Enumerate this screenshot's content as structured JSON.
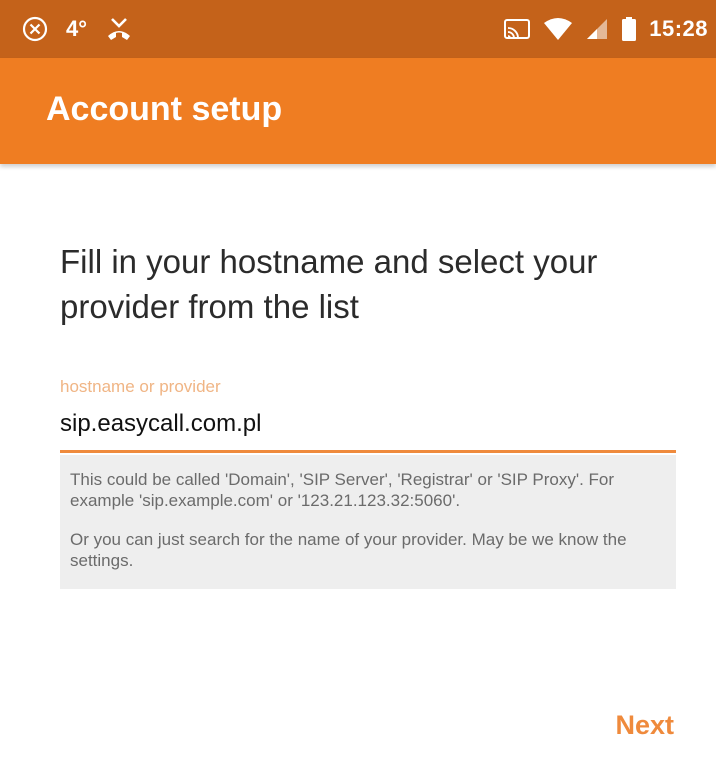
{
  "status_bar": {
    "left_icons": [
      "close-circle-icon",
      "phone-missed-icon"
    ],
    "temperature": "4°",
    "right_icons": [
      "cast-icon",
      "wifi-icon",
      "signal-icon",
      "battery-icon"
    ],
    "time": "15:28"
  },
  "app_bar": {
    "title": "Account setup"
  },
  "main": {
    "heading": "Fill in your hostname and select your provider from the list",
    "field": {
      "label": "hostname or provider",
      "value": "sip.easycall.com.pl"
    },
    "help": {
      "paragraph1": "This could be called 'Domain', 'SIP Server', 'Registrar' or 'SIP Proxy'. For example 'sip.example.com' or '123.21.123.32:5060'.",
      "paragraph2": "Or you can just search for the name of your provider. May be we know the settings."
    },
    "next_label": "Next"
  },
  "colors": {
    "status_bar": "#c4621a",
    "app_bar": "#ef7d22",
    "accent": "#ef8a3c",
    "help_background": "#eeeeee"
  }
}
